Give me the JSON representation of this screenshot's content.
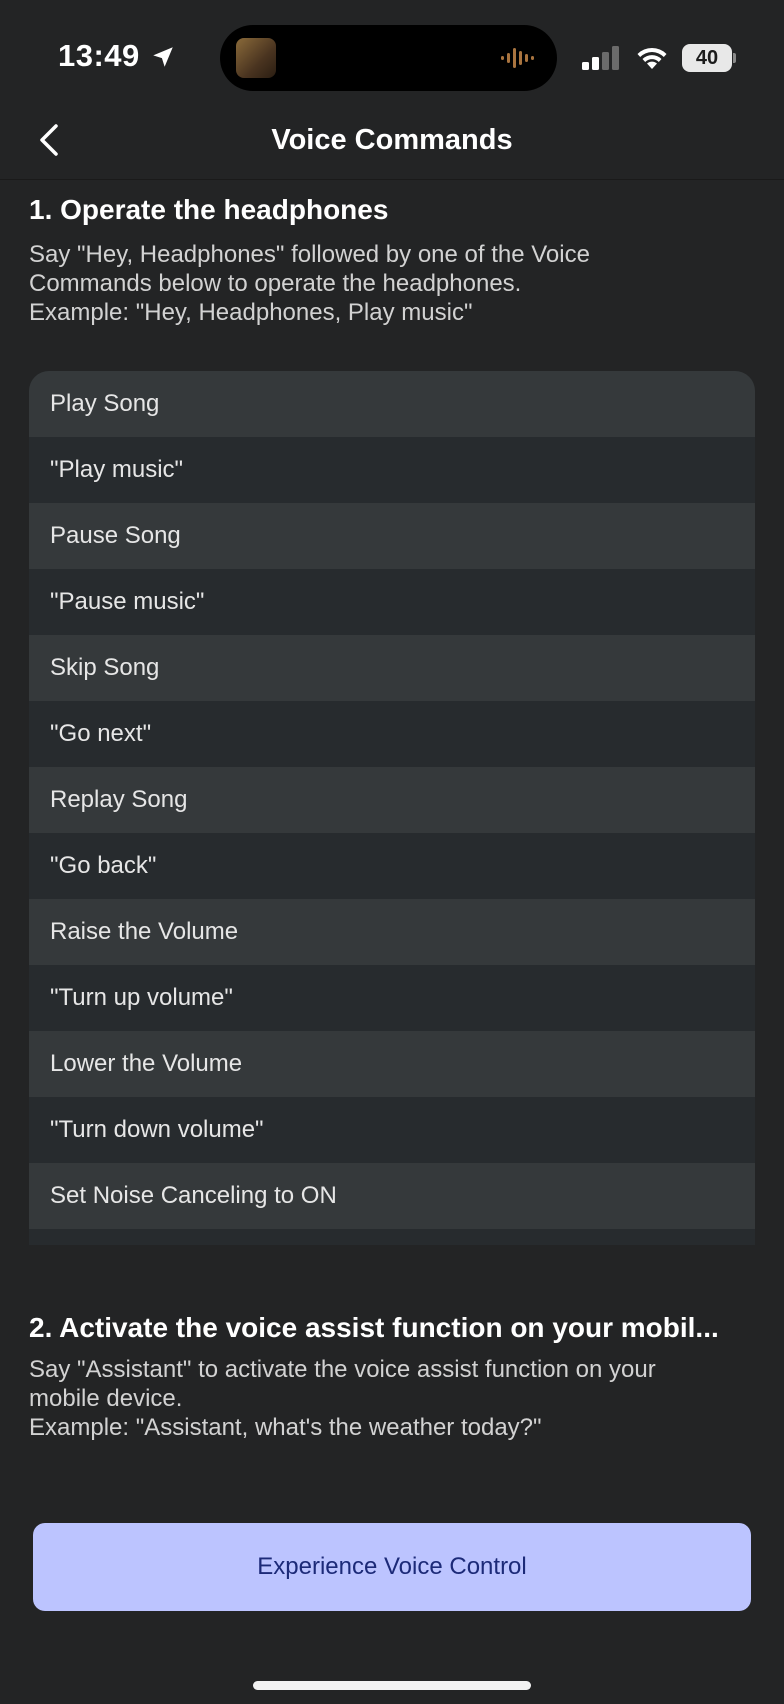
{
  "status_bar": {
    "time": "13:49",
    "battery": "40",
    "icons": [
      "location-arrow-icon",
      "now-playing-art",
      "audio-wave-icon",
      "cellular-signal-icon",
      "wifi-icon",
      "battery-icon"
    ]
  },
  "header": {
    "title": "Voice Commands",
    "back_icon": "chevron-left-icon"
  },
  "section1": {
    "title": "1. Operate the headphones",
    "description_lines": [
      "Say \"Hey, Headphones\" followed by one of the Voice",
      "Commands below to operate the headphones.",
      "Example: \"Hey, Headphones, Play music\""
    ]
  },
  "commands": [
    {
      "action": "Play Song",
      "phrase": "\"Play music\""
    },
    {
      "action": "Pause Song",
      "phrase": "\"Pause music\""
    },
    {
      "action": "Skip Song",
      "phrase": "\"Go next\""
    },
    {
      "action": "Replay Song",
      "phrase": "\"Go back\""
    },
    {
      "action": "Raise the Volume",
      "phrase": "\"Turn up volume\""
    },
    {
      "action": "Lower the Volume",
      "phrase": "\"Turn down volume\""
    },
    {
      "action": "Set Noise Canceling to ON",
      "phrase": ""
    }
  ],
  "section2": {
    "title": "2. Activate the voice assist function on your mobil...",
    "description_lines": [
      "Say \"Assistant\" to activate the voice assist function on your",
      "mobile device.",
      "Example: \"Assistant, what's the weather today?\""
    ]
  },
  "cta": {
    "label": "Experience Voice Control"
  },
  "colors": {
    "background": "#232425",
    "row_category": "#35393b",
    "row_command": "#272b2e",
    "button_bg": "#bcc4ff",
    "button_text": "#1c2a78"
  }
}
